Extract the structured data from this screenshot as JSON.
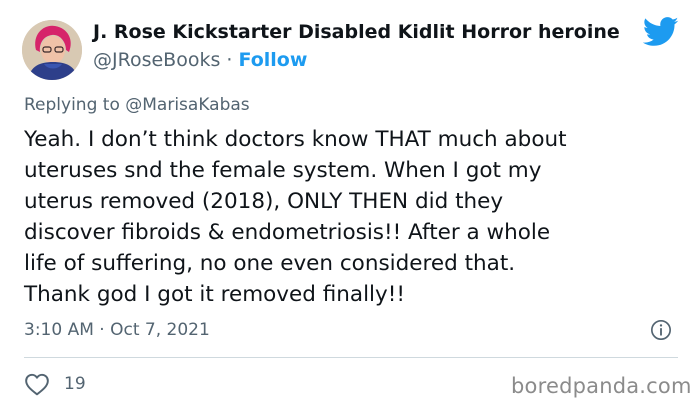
{
  "author": {
    "display_name": "J. Rose Kickstarter Disabled Kidlit Horror heroine",
    "handle": "@JRoseBooks",
    "separator": " · ",
    "follow_label": "Follow"
  },
  "reply": {
    "prefix": "Replying to ",
    "to_handle": "@MarisaKabas"
  },
  "tweet": {
    "lines": [
      "Yeah. I don’t think doctors know THAT much about",
      "uteruses snd the female system. When I got my",
      "uterus removed (2018), ONLY THEN did they",
      "discover fibroids & endometriosis!! After a whole",
      "life of suffering, no one even considered that.",
      "Thank god I got it removed finally!!"
    ],
    "timestamp": "3:10 AM · Oct 7, 2021",
    "like_count": "19"
  },
  "icons": {
    "brand": "twitter-bird-icon",
    "info": "info-icon",
    "like": "heart-icon"
  },
  "colors": {
    "accent": "#1d9bf0",
    "secondary_text": "#536471",
    "primary_text": "#0f1419"
  },
  "watermark": "boredpanda.com"
}
